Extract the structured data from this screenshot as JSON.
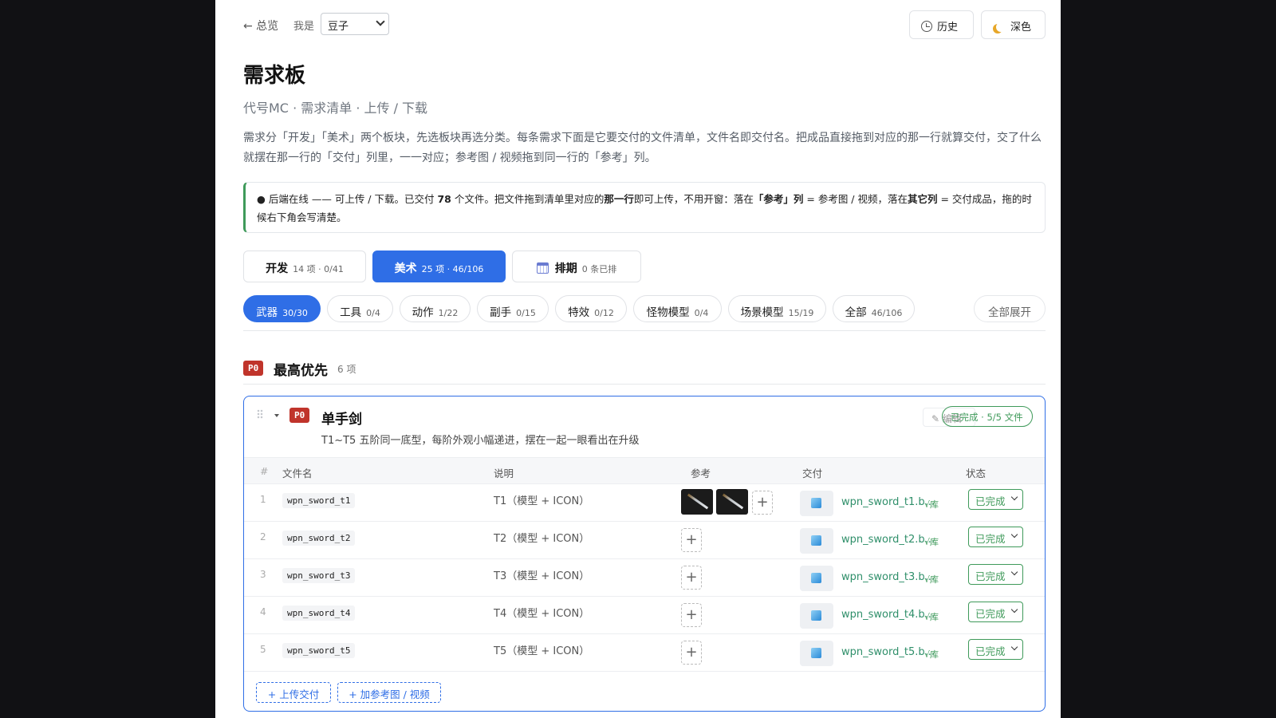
{
  "topbar": {
    "back_label": "← 总览",
    "who_label": "我是",
    "who_value": "豆子",
    "history_label": "历史",
    "dark_label": "深色"
  },
  "header": {
    "title": "需求板",
    "subtitle": "代号MC · 需求清单 · 上传 / 下载",
    "description": "需求分「开发」「美术」两个板块，先选板块再选分类。每条需求下面是它要交付的文件清单，文件名即交付名。把成品直接拖到对应的那一行就算交付，交了什么就摆在那一行的「交付」列里，一一对应；参考图 / 视频拖到同一行的「参考」列。"
  },
  "notice": {
    "p1": "● 后端在线 —— 可上传 / 下载。已交付 ",
    "count": "78",
    "p2": " 个文件。把文件拖到清单里对应的",
    "row_word": "那一行",
    "p3": "即可上传，不用开窗：落在",
    "ref_col": "「参考」列",
    "p4": " = 参考图 / 视频，落在",
    "other_col": "其它列",
    "p5": " = 交付成品，拖的时候右下角会写清楚。"
  },
  "boards": [
    {
      "name": "开发",
      "meta": "14 项 · 0/41"
    },
    {
      "name": "美术",
      "meta": "25 项 · 46/106"
    },
    {
      "name": "排期",
      "meta": "0 条已排"
    }
  ],
  "categories": [
    {
      "name": "武器",
      "meta": "30/30"
    },
    {
      "name": "工具",
      "meta": "0/4"
    },
    {
      "name": "动作",
      "meta": "1/22"
    },
    {
      "name": "副手",
      "meta": "0/15"
    },
    {
      "name": "特效",
      "meta": "0/12"
    },
    {
      "name": "怪物模型",
      "meta": "0/4"
    },
    {
      "name": "场景模型",
      "meta": "15/19"
    },
    {
      "name": "全部",
      "meta": "46/106"
    }
  ],
  "expand_all": "全部展开",
  "group": {
    "badge": "P0",
    "title": "最高优先",
    "count": "6 项"
  },
  "item": {
    "badge": "P0",
    "title": "单手剑",
    "description": "T1~T5 五阶同一底型，每阶外观小幅递进，摆在一起一眼看出在升级",
    "edit_label": "✎ 编辑",
    "done_label": "已完成 · 5/5 文件",
    "columns": {
      "num": "#",
      "name": "文件名",
      "desc": "说明",
      "ref": "参考",
      "deliv": "交付",
      "status": "状态"
    },
    "rows": [
      {
        "num": "1",
        "file": "wpn_sword_t1",
        "desc": "T1（模型 + ICON）",
        "deliv": "wpn_sword_t1.b...",
        "lib": "√库",
        "status": "已完成"
      },
      {
        "num": "2",
        "file": "wpn_sword_t2",
        "desc": "T2（模型 + ICON）",
        "deliv": "wpn_sword_t2.b...",
        "lib": "√库",
        "status": "已完成"
      },
      {
        "num": "3",
        "file": "wpn_sword_t3",
        "desc": "T3（模型 + ICON）",
        "deliv": "wpn_sword_t3.b...",
        "lib": "√库",
        "status": "已完成"
      },
      {
        "num": "4",
        "file": "wpn_sword_t4",
        "desc": "T4（模型 + ICON）",
        "deliv": "wpn_sword_t4.b...",
        "lib": "√库",
        "status": "已完成"
      },
      {
        "num": "5",
        "file": "wpn_sword_t5",
        "desc": "T5（模型 + ICON）",
        "deliv": "wpn_sword_t5.b...",
        "lib": "√库",
        "status": "已完成"
      }
    ],
    "add_ref_label": "+",
    "upload_label": "+ 上传交付",
    "add_media_label": "+ 加参考图 / 视频"
  },
  "colors": {
    "accent": "#2f6ee6",
    "success": "#3f9a5a",
    "priority": "#c0342b"
  }
}
